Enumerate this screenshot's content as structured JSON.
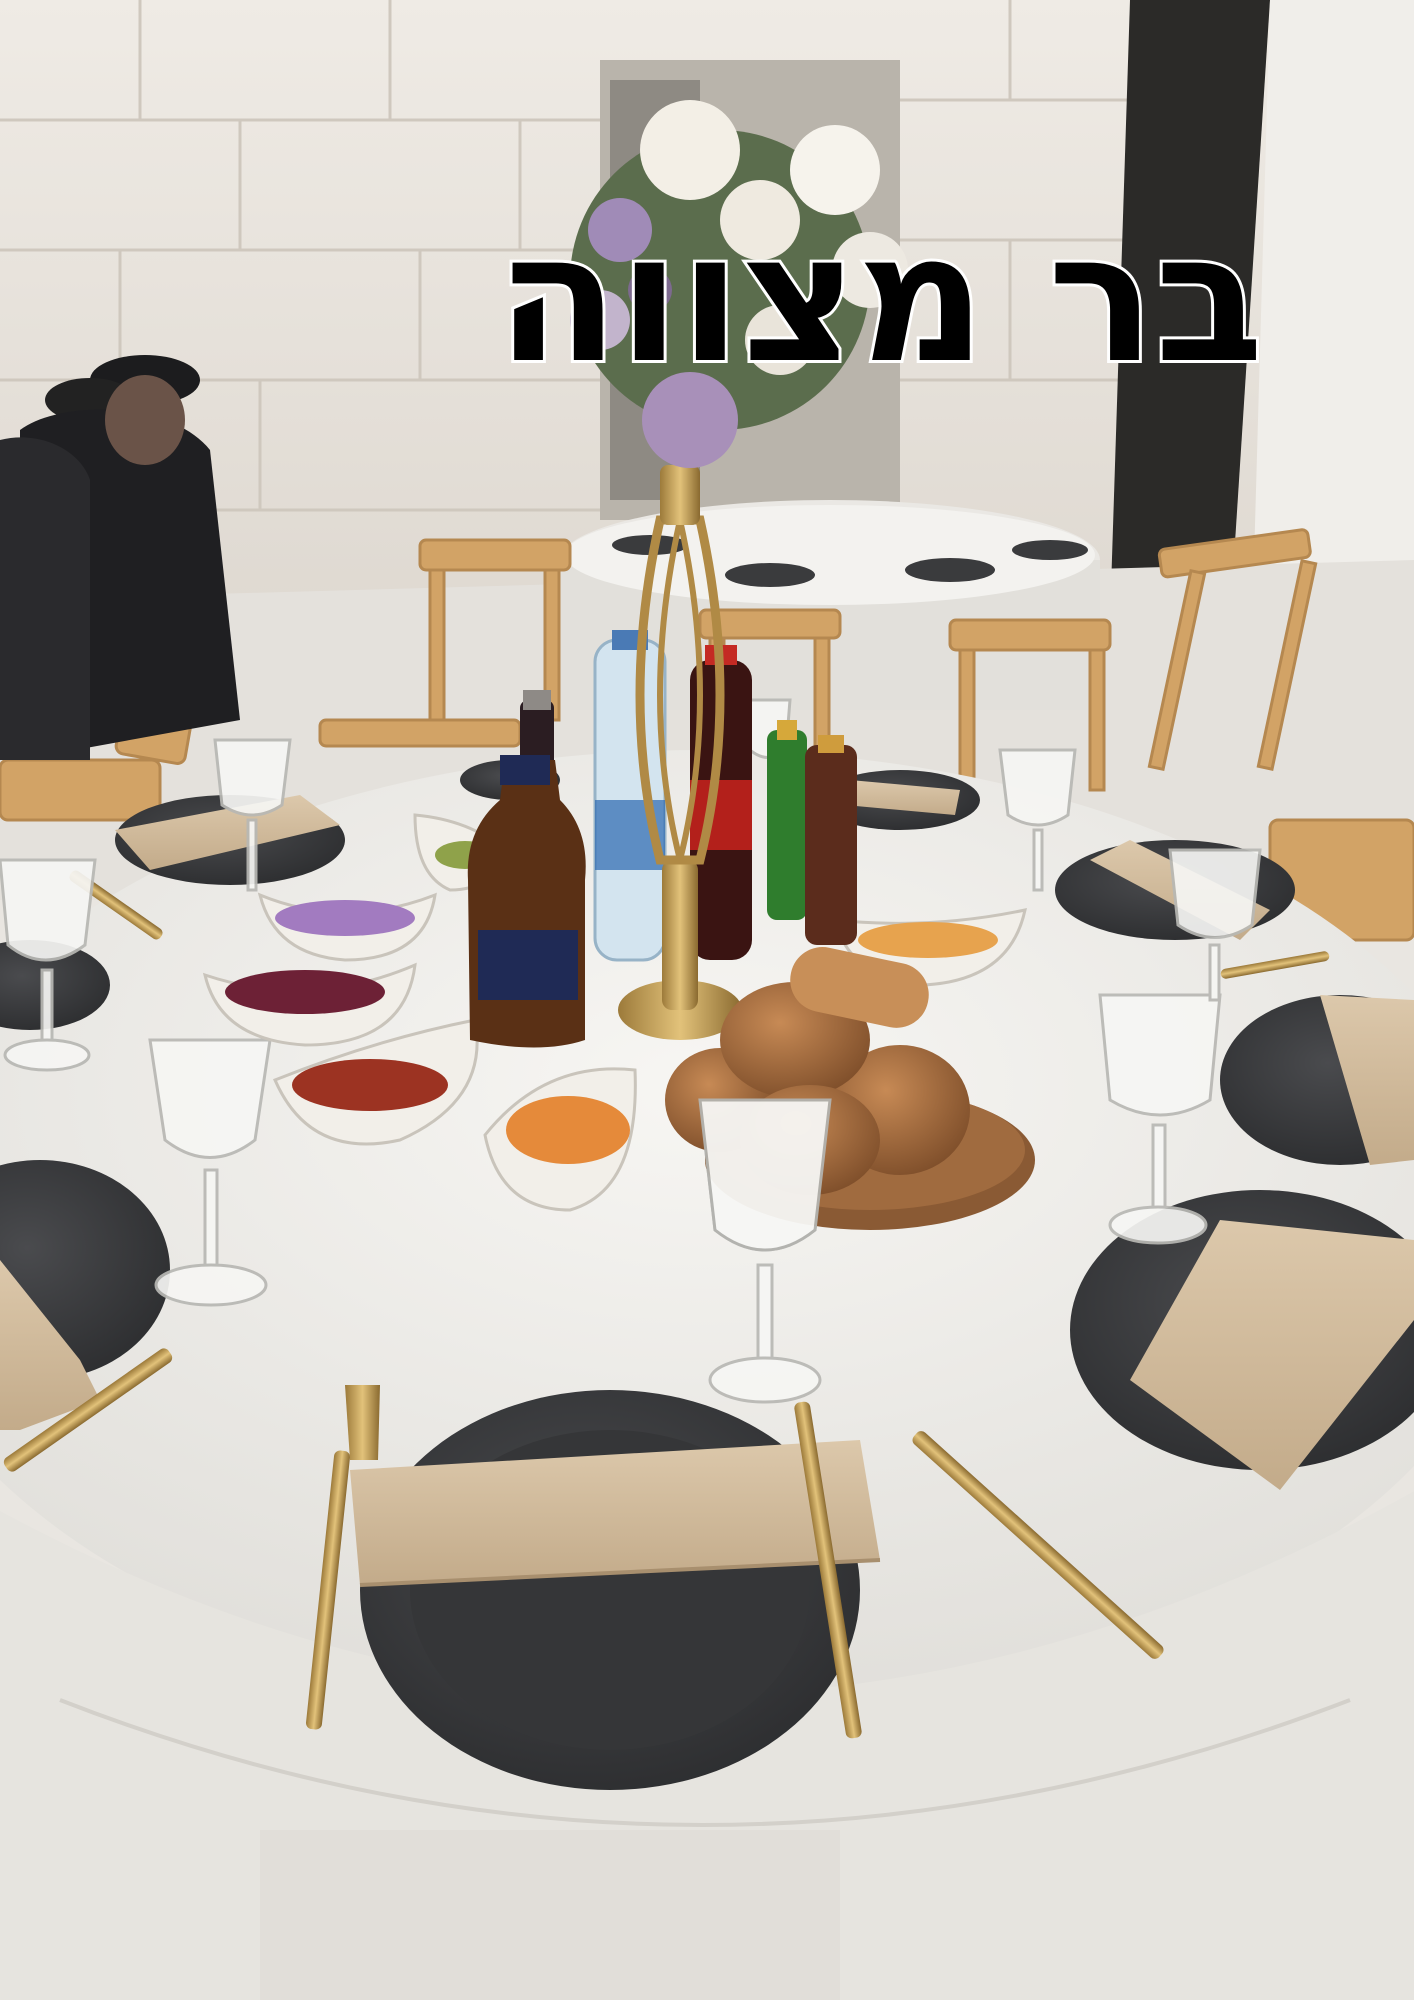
{
  "title": "בר מצווה",
  "colors": {
    "wall": "#e6e1d9",
    "tablecloth": "#efeeea",
    "plate": "#3a3b3d",
    "napkin": "#d3bea0",
    "cutlery": "#c9a24a",
    "wood_chair": "#d2a366"
  }
}
